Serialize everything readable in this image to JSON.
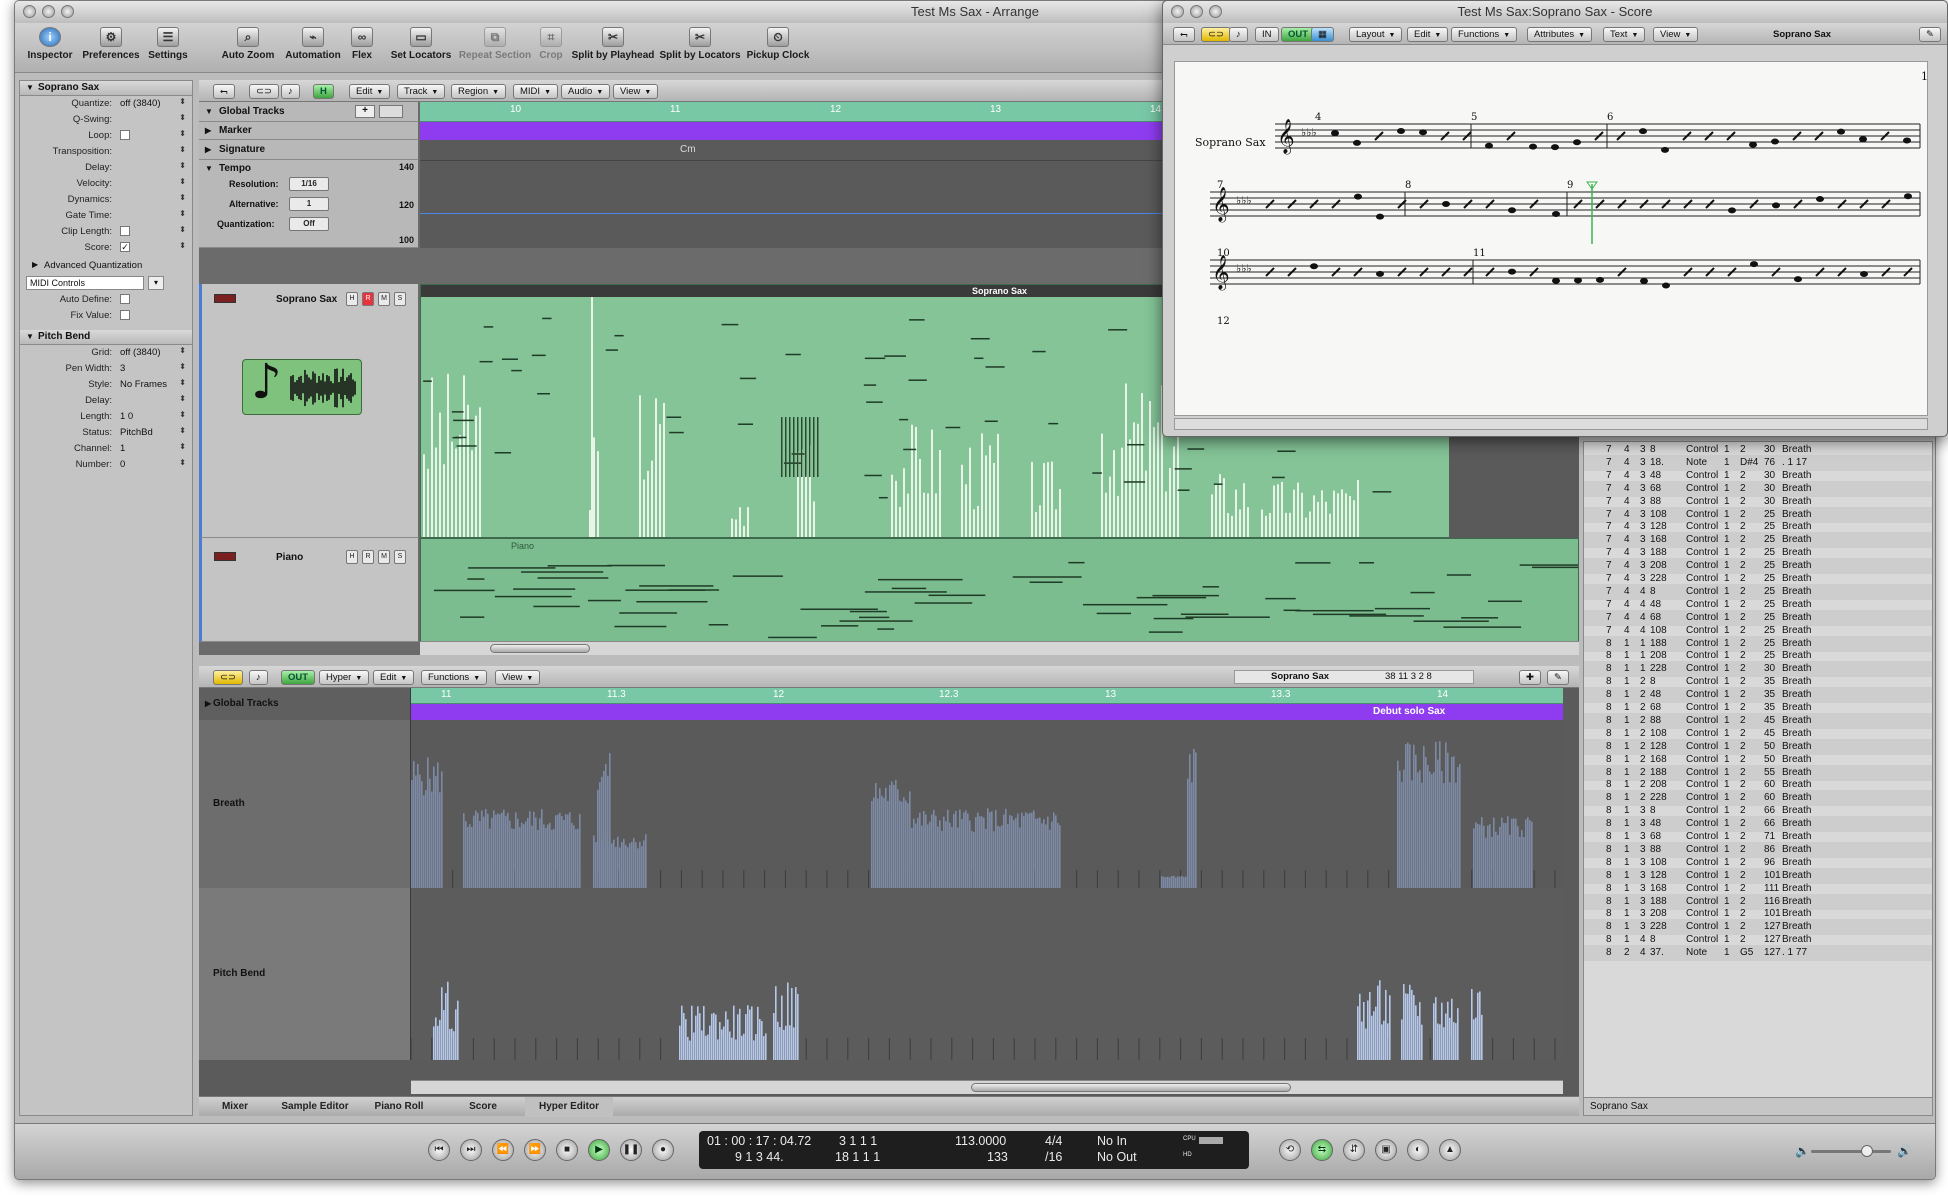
{
  "arrange_window": {
    "title": "Test Ms Sax - Arrange",
    "toolbar": [
      {
        "label": "Inspector",
        "icon": "info-icon"
      },
      {
        "label": "Preferences",
        "icon": "preferences-icon"
      },
      {
        "label": "Settings",
        "icon": "settings-icon"
      },
      {
        "label": "Auto Zoom",
        "icon": "zoom-icon"
      },
      {
        "label": "Automation",
        "icon": "automation-icon"
      },
      {
        "label": "Flex",
        "icon": "flex-icon"
      },
      {
        "label": "Set Locators",
        "icon": "set-locators-icon"
      },
      {
        "label": "Repeat Section",
        "icon": "repeat-section-icon"
      },
      {
        "label": "Crop",
        "icon": "crop-icon"
      },
      {
        "label": "Split by Playhead",
        "icon": "split-playhead-icon"
      },
      {
        "label": "Split by Locators",
        "icon": "split-locators-icon"
      },
      {
        "label": "Pickup Clock",
        "icon": "pickup-clock-icon"
      }
    ]
  },
  "inspector": {
    "region_header": "Soprano Sax",
    "region_params": [
      {
        "label": "Quantize:",
        "value": "off (3840)"
      },
      {
        "label": "Q-Swing:",
        "value": ""
      },
      {
        "label": "Loop:",
        "value": "checkbox"
      },
      {
        "label": "Transposition:",
        "value": ""
      },
      {
        "label": "Delay:",
        "value": ""
      },
      {
        "label": "Velocity:",
        "value": ""
      },
      {
        "label": "Dynamics:",
        "value": ""
      },
      {
        "label": "Gate Time:",
        "value": ""
      },
      {
        "label": "Clip Length:",
        "value": "checkbox"
      },
      {
        "label": "Score:",
        "value": "checked"
      }
    ],
    "advanced": "Advanced Quantization",
    "midi_controls": "MIDI Controls",
    "auto_define": "Auto Define:",
    "fix_value": "Fix Value:",
    "pitch_header": "Pitch Bend",
    "pitch_params": [
      {
        "label": "Grid:",
        "value": "off (3840)"
      },
      {
        "label": "Pen Width:",
        "value": "3"
      },
      {
        "label": "Style:",
        "value": "No Frames"
      },
      {
        "label": "Delay:",
        "value": ""
      },
      {
        "label": "Length:",
        "value": "1    0"
      },
      {
        "label": "Status:",
        "value": "PitchBd"
      },
      {
        "label": "Channel:",
        "value": "1"
      },
      {
        "label": "Number:",
        "value": "0"
      }
    ]
  },
  "arrange_menu": {
    "edit": "Edit",
    "track": "Track",
    "region": "Region",
    "midi": "MIDI",
    "audio": "Audio",
    "view": "View",
    "h": "H"
  },
  "global_tracks": {
    "title": "Global Tracks",
    "marker": "Marker",
    "signature": "Signature",
    "signature_chord": "Cm",
    "tempo": "Tempo",
    "tempo_max": "140",
    "tempo_mid": "120",
    "tempo_min": "100",
    "resolution_label": "Resolution:",
    "resolution": "1/16",
    "alternative_label": "Alternative:",
    "alternative": "1",
    "quantization_label": "Quantization:",
    "quantization": "Off"
  },
  "ruler": [
    "10",
    "11",
    "12",
    "13",
    "14"
  ],
  "tracks": [
    {
      "name": "Soprano Sax",
      "region": "Soprano Sax"
    },
    {
      "name": "Piano",
      "region": "Piano"
    }
  ],
  "hyper": {
    "menu": {
      "hyper": "Hyper",
      "edit": "Edit",
      "functions": "Functions",
      "view": "View"
    },
    "track_name": "Soprano Sax",
    "position": "38   11 3 2 8",
    "global_tracks": "Global Tracks",
    "ruler": [
      "11",
      "11.3",
      "12",
      "12.3",
      "13",
      "13.3",
      "14"
    ],
    "marker": "Debut solo Sax",
    "lanes": [
      "Breath",
      "Pitch Bend"
    ]
  },
  "event_list": {
    "rows": [
      [
        "7",
        "4",
        "3",
        "8",
        "Control",
        "1",
        "2",
        "30",
        "Breath"
      ],
      [
        "7",
        "4",
        "3",
        "18.",
        "Note",
        "1",
        "D#4",
        "76",
        ". 1 17"
      ],
      [
        "7",
        "4",
        "3",
        "48",
        "Control",
        "1",
        "2",
        "30",
        "Breath"
      ],
      [
        "7",
        "4",
        "3",
        "68",
        "Control",
        "1",
        "2",
        "30",
        "Breath"
      ],
      [
        "7",
        "4",
        "3",
        "88",
        "Control",
        "1",
        "2",
        "30",
        "Breath"
      ],
      [
        "7",
        "4",
        "3",
        "108",
        "Control",
        "1",
        "2",
        "25",
        "Breath"
      ],
      [
        "7",
        "4",
        "3",
        "128",
        "Control",
        "1",
        "2",
        "25",
        "Breath"
      ],
      [
        "7",
        "4",
        "3",
        "168",
        "Control",
        "1",
        "2",
        "25",
        "Breath"
      ],
      [
        "7",
        "4",
        "3",
        "188",
        "Control",
        "1",
        "2",
        "25",
        "Breath"
      ],
      [
        "7",
        "4",
        "3",
        "208",
        "Control",
        "1",
        "2",
        "25",
        "Breath"
      ],
      [
        "7",
        "4",
        "3",
        "228",
        "Control",
        "1",
        "2",
        "25",
        "Breath"
      ],
      [
        "7",
        "4",
        "4",
        "8",
        "Control",
        "1",
        "2",
        "25",
        "Breath"
      ],
      [
        "7",
        "4",
        "4",
        "48",
        "Control",
        "1",
        "2",
        "25",
        "Breath"
      ],
      [
        "7",
        "4",
        "4",
        "68",
        "Control",
        "1",
        "2",
        "25",
        "Breath"
      ],
      [
        "7",
        "4",
        "4",
        "108",
        "Control",
        "1",
        "2",
        "25",
        "Breath"
      ],
      [
        "8",
        "1",
        "1",
        "188",
        "Control",
        "1",
        "2",
        "25",
        "Breath"
      ],
      [
        "8",
        "1",
        "1",
        "208",
        "Control",
        "1",
        "2",
        "25",
        "Breath"
      ],
      [
        "8",
        "1",
        "1",
        "228",
        "Control",
        "1",
        "2",
        "30",
        "Breath"
      ],
      [
        "8",
        "1",
        "2",
        "8",
        "Control",
        "1",
        "2",
        "35",
        "Breath"
      ],
      [
        "8",
        "1",
        "2",
        "48",
        "Control",
        "1",
        "2",
        "35",
        "Breath"
      ],
      [
        "8",
        "1",
        "2",
        "68",
        "Control",
        "1",
        "2",
        "35",
        "Breath"
      ],
      [
        "8",
        "1",
        "2",
        "88",
        "Control",
        "1",
        "2",
        "45",
        "Breath"
      ],
      [
        "8",
        "1",
        "2",
        "108",
        "Control",
        "1",
        "2",
        "45",
        "Breath"
      ],
      [
        "8",
        "1",
        "2",
        "128",
        "Control",
        "1",
        "2",
        "50",
        "Breath"
      ],
      [
        "8",
        "1",
        "2",
        "168",
        "Control",
        "1",
        "2",
        "50",
        "Breath"
      ],
      [
        "8",
        "1",
        "2",
        "188",
        "Control",
        "1",
        "2",
        "55",
        "Breath"
      ],
      [
        "8",
        "1",
        "2",
        "208",
        "Control",
        "1",
        "2",
        "60",
        "Breath"
      ],
      [
        "8",
        "1",
        "2",
        "228",
        "Control",
        "1",
        "2",
        "60",
        "Breath"
      ],
      [
        "8",
        "1",
        "3",
        "8",
        "Control",
        "1",
        "2",
        "66",
        "Breath"
      ],
      [
        "8",
        "1",
        "3",
        "48",
        "Control",
        "1",
        "2",
        "66",
        "Breath"
      ],
      [
        "8",
        "1",
        "3",
        "68",
        "Control",
        "1",
        "2",
        "71",
        "Breath"
      ],
      [
        "8",
        "1",
        "3",
        "88",
        "Control",
        "1",
        "2",
        "86",
        "Breath"
      ],
      [
        "8",
        "1",
        "3",
        "108",
        "Control",
        "1",
        "2",
        "96",
        "Breath"
      ],
      [
        "8",
        "1",
        "3",
        "128",
        "Control",
        "1",
        "2",
        "101",
        "Breath"
      ],
      [
        "8",
        "1",
        "3",
        "168",
        "Control",
        "1",
        "2",
        "111",
        "Breath"
      ],
      [
        "8",
        "1",
        "3",
        "188",
        "Control",
        "1",
        "2",
        "116",
        "Breath"
      ],
      [
        "8",
        "1",
        "3",
        "208",
        "Control",
        "1",
        "2",
        "101",
        "Breath"
      ],
      [
        "8",
        "1",
        "3",
        "228",
        "Control",
        "1",
        "2",
        "127",
        "Breath"
      ],
      [
        "8",
        "1",
        "4",
        "8",
        "Control",
        "1",
        "2",
        "127",
        "Breath"
      ],
      [
        "8",
        "2",
        "4",
        "37.",
        "Note",
        "1",
        "G5",
        "127",
        ". 1 77"
      ]
    ],
    "footer": "Soprano Sax"
  },
  "tabs": [
    "Mixer",
    "Sample Editor",
    "Piano Roll",
    "Score",
    "Hyper Editor"
  ],
  "transport": {
    "smpte": "01 : 00 : 17 : 04.72",
    "bars": "9   1   3   44.",
    "left_locator": "3   1   1   1",
    "right_locator": "18   1   1   1",
    "tempo": "113.0000",
    "tempo_sub": "133",
    "signature": "4/4",
    "division": "/16",
    "in": "No In",
    "out": "No Out",
    "cpu": "CPU",
    "hd": "HD"
  },
  "score_window": {
    "title": "Test Ms Sax:Soprano Sax - Score",
    "menu": {
      "layout": "Layout",
      "edit": "Edit",
      "functions": "Functions",
      "attributes": "Attributes",
      "text": "Text",
      "view": "View"
    },
    "instrument_right": "Soprano Sax",
    "page_number": "1",
    "staff_name": "Soprano Sax",
    "bars": [
      "4",
      "5",
      "6",
      "7",
      "8",
      "9",
      "10",
      "11",
      "12"
    ]
  },
  "colors": {
    "ruler": "#78c7a5",
    "region": "#84c497",
    "marker": "#8f3cf0",
    "bars": "#7d8aa5",
    "pitch": "#b6c8ea"
  }
}
